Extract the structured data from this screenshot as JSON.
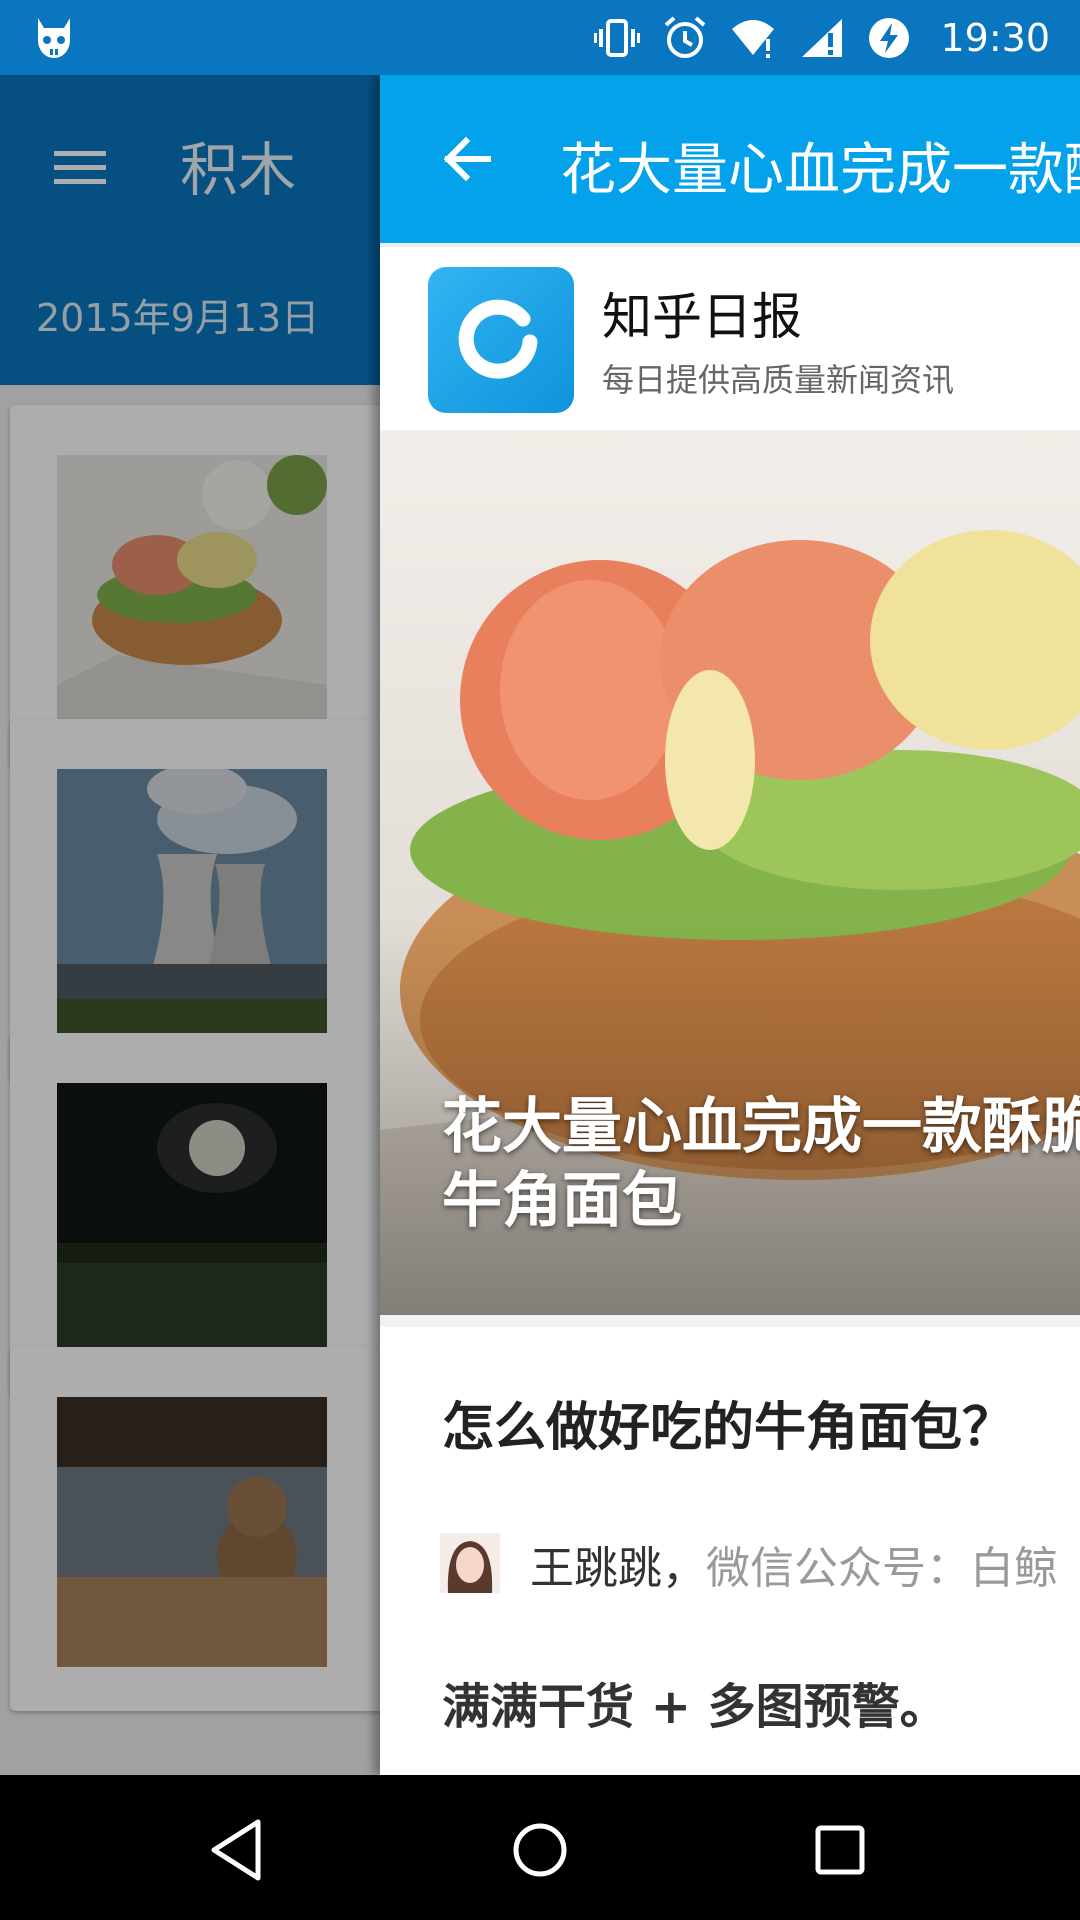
{
  "status_bar": {
    "time": "19:30",
    "icons": [
      "app-notification-icon",
      "vibrate-icon",
      "alarm-icon",
      "wifi-icon",
      "signal-icon",
      "battery-charging-icon"
    ]
  },
  "background_app": {
    "title": "积木",
    "date": "2015年9月13日",
    "menu_icon": "hamburger-menu-icon",
    "cards": [
      {
        "thumb": "croissant-photo"
      },
      {
        "thumb": "cooling-towers-photo"
      },
      {
        "thumb": "moon-field-photo"
      },
      {
        "thumb": "teddy-bear-photo"
      }
    ]
  },
  "detail": {
    "toolbar_title": "花大量心血完成一款酥脆的牛角面包",
    "back_icon": "arrow-left-icon",
    "source": {
      "name": "知乎日报",
      "description": "每日提供高质量新闻资讯"
    },
    "hero_title": "花大量心血完成一款酥脆的牛角面包",
    "question": "怎么做好吃的牛角面包？",
    "author_name": "王跳跳，",
    "author_bio": "微信公众号：白鲸",
    "summary": "满满干货 + 多图预警。"
  },
  "nav_bar": {
    "back": "nav-back-icon",
    "home": "nav-home-icon",
    "recents": "nav-recents-icon"
  },
  "colors": {
    "status_bar": "#0a76bf",
    "bg_toolbar": "#0a76bf",
    "detail_toolbar": "#05a2ec",
    "logo": "#1ea4ea"
  }
}
